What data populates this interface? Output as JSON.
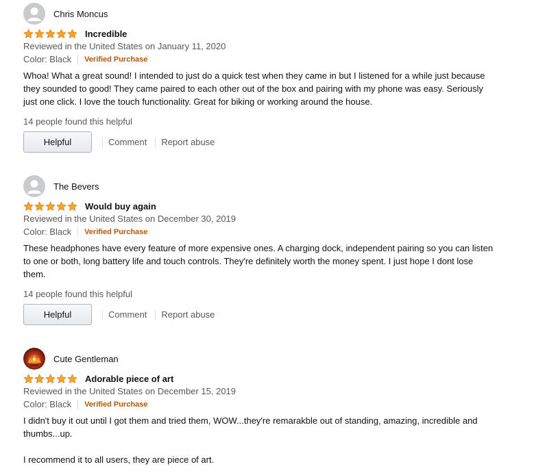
{
  "reviews": [
    {
      "profile_name": "Chris Moncus",
      "avatar": "default-person-icon",
      "rating": 5,
      "title": "Incredible",
      "date": "Reviewed in the United States on January 11, 2020",
      "format": "Color: Black",
      "verified": "Verified Purchase",
      "body": [
        "Whoa! What a great sound! I intended to just do a quick test when they came in but I listened for a while just because they sounded to good! They came paired to each other out of the box and pairing with my phone was easy. Seriously just one click. I love the touch functionality. Great for biking or working around the house."
      ],
      "helpful_count": "14 people found this helpful",
      "helpful_label": "Helpful",
      "comment_label": "Comment",
      "report_label": "Report abuse"
    },
    {
      "profile_name": "The Bevers",
      "avatar": "default-person-icon",
      "rating": 5,
      "title": "Would buy again",
      "date": "Reviewed in the United States on December 30, 2019",
      "format": "Color: Black",
      "verified": "Verified Purchase",
      "body": [
        "These headphones have every feature of more expensive ones. A charging dock, independent pairing so you can listen to one or both, long battery life and touch controls. They're definitely worth the money spent. I just hope I dont lose them."
      ],
      "helpful_count": "14 people found this helpful",
      "helpful_label": "Helpful",
      "comment_label": "Comment",
      "report_label": "Report abuse"
    },
    {
      "profile_name": "Cute Gentleman",
      "avatar": "custom-photo-avatar",
      "rating": 5,
      "title": "Adorable piece of art",
      "date": "Reviewed in the United States on December 15, 2019",
      "format": "Color: Black",
      "verified": "Verified Purchase",
      "body": [
        "I didn't buy it out until I got them and tried them, WOW...they're remarakble out of standing, amazing, incredible and thumbs...up.",
        "I recommend it to all users, they are piece of art."
      ]
    }
  ],
  "colors": {
    "star_fill": "#ffa41c",
    "star_stroke": "#de7921",
    "verified": "#c45500",
    "muted_text": "#565959"
  }
}
